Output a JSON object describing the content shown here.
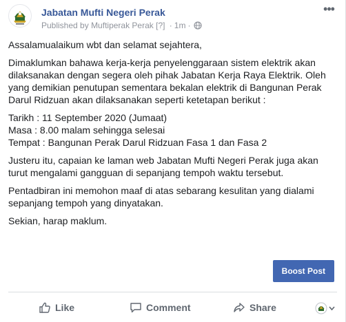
{
  "header": {
    "page_name": "Jabatan Mufti Negeri Perak",
    "published_by": "Published by",
    "publisher": "Muftiperak Perak",
    "bracket": "[?]",
    "separator": "·",
    "time": "1m",
    "sep2": "·"
  },
  "post": {
    "greeting": "Assalamualaikum wbt dan selamat sejahtera,",
    "para1": "Dimaklumkan bahawa kerja-kerja penyelenggaraan sistem elektrik akan dilaksanakan dengan segera oleh pihak Jabatan Kerja Raya Elektrik. Oleh yang demikian penutupan sementara bekalan elektrik di Bangunan Perak Darul Ridzuan akan dilaksanakan seperti ketetapan berikut :",
    "date_line": "Tarikh : 11 September 2020 (Jumaat)",
    "time_line": "Masa : 8.00 malam sehingga selesai",
    "place_line": "Tempat : Bangunan Perak Darul Ridzuan Fasa 1 dan Fasa 2",
    "para2": "Justeru itu, capaian ke laman web Jabatan Mufti Negeri Perak juga akan turut mengalami gangguan di sepanjang tempoh waktu tersebut.",
    "para3": "Pentadbiran ini memohon maaf di atas sebarang kesulitan yang dialami sepanjang tempoh yang dinyatakan.",
    "closing": "Sekian, harap maklum."
  },
  "boost_label": "Boost Post",
  "actions": {
    "like": "Like",
    "comment": "Comment",
    "share": "Share"
  },
  "icons": {
    "avatar": "mufti-perak-crest-icon",
    "options": "ellipsis-icon",
    "globe": "globe-icon",
    "like": "thumbs-up-icon",
    "comment": "comment-bubble-icon",
    "share": "share-arrow-icon",
    "reaction": "page-avatar-dropdown-icon"
  },
  "colors": {
    "link": "#385898",
    "boost": "#4267b2",
    "muted": "#90949c",
    "action": "#606770"
  }
}
